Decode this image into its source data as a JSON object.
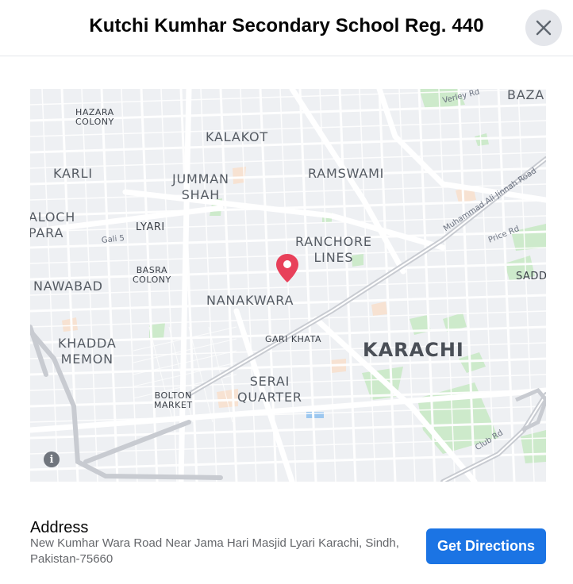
{
  "dialog": {
    "title": "Kutchi Kumhar Secondary School Reg. 440",
    "close_icon": "close-icon"
  },
  "map": {
    "labels": {
      "hazara_colony": "HAZARA\nCOLONY",
      "kalakot": "KALAKOT",
      "karli": "KARLI",
      "jumman_shah": "JUMMAN\nSHAH",
      "ramswami": "RAMSWAMI",
      "baloch_para": "ALOCH\nPARA",
      "lyari": "LYARI",
      "ranchore_lines": "RANCHORE\nLINES",
      "basra_colony": "BASRA\nCOLONY",
      "nawabad": "NAWABAD",
      "nanakwara": "NANAKWARA",
      "kharadar": "KHADDA\nMEMON",
      "gari_khata": "GARI KHATA",
      "karachi": "KARACHI",
      "serai_quarter": "SERAI\nQUARTER",
      "bolton_market": "BOLTON\nMARKET",
      "baza": "BAZA",
      "saddar": "SADD"
    },
    "roads": {
      "verley": "Verley Rd",
      "jinnah": "Muhammad Ali Jinnah Road",
      "price": "Price Rd",
      "club": "Club Rd",
      "gali5": "Gali 5"
    },
    "info_icon": "info-icon",
    "pin_icon": "map-pin-icon",
    "colors": {
      "pin": "#e8405a",
      "park": "#cdeacb",
      "water": "#9cc7ef",
      "land": "#eef0f3"
    }
  },
  "address": {
    "title": "Address",
    "text": "New Kumhar Wara Road Near Jama Hari Masjid Lyari Karachi, Sindh, Pakistan-75660"
  },
  "actions": {
    "directions_label": "Get Directions"
  }
}
